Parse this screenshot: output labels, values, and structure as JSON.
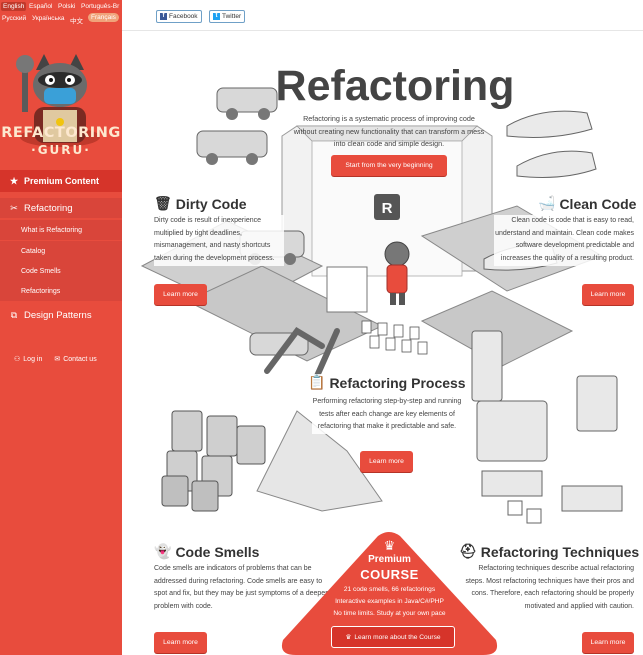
{
  "languages": [
    "English",
    "Español",
    "Polski",
    "Português-Br",
    "Русский",
    "Українська",
    "中文",
    "Français"
  ],
  "brand": {
    "line1": "REFACTORING",
    "line2": "·GURU·"
  },
  "sidebar": {
    "premium": "Premium Content",
    "refactoring": "Refactoring",
    "sub": [
      "What is Refactoring",
      "Catalog",
      "Code Smells",
      "Refactorings"
    ],
    "design_patterns": "Design Patterns",
    "login": "Log in",
    "contact": "Contact us"
  },
  "share": {
    "facebook": "Facebook",
    "twitter": "Twitter"
  },
  "hero": {
    "title": "Refactoring",
    "desc": "Refactoring is a systematic process of improving code without creating new functionality that can transform a mess into clean code and simple design.",
    "cta": "Start from the very beginning"
  },
  "dirty": {
    "title": "Dirty Code",
    "text": "Dirty code is result of inexperience multiplied by tight deadlines, mismanagement, and nasty shortcuts taken during the development process.",
    "btn": "Learn more"
  },
  "clean": {
    "title": "Clean Code",
    "text": "Clean code is code that is easy to read, understand and maintain. Clean code makes software development predictable and increases the quality of a resulting product.",
    "btn": "Learn more"
  },
  "process": {
    "title": "Refactoring Process",
    "text": "Performing refactoring step-by-step and running tests after each change are key elements of refactoring that make it predictable and safe.",
    "btn": "Learn more"
  },
  "smells": {
    "title": "Code Smells",
    "text": "Code smells are indicators of problems that can be addressed during refactoring. Code smells are easy to spot and fix, but they may be just symptoms of a deeper problem with code.",
    "btn": "Learn more"
  },
  "techniques": {
    "title": "Refactoring Techniques",
    "text": "Refactoring techniques describe actual refactoring steps. Most refactoring techniques have their pros and cons. Therefore, each refactoring should be properly motivated and applied with caution.",
    "btn": "Learn more"
  },
  "premium": {
    "label1": "Premium",
    "label2": "COURSE",
    "line1": "21 code smells, 66 refactorings",
    "line2": "Interactive examples in Java/C#/PHP",
    "line3": "No time limits. Study at your own pace",
    "btn": "Learn more about the Course"
  },
  "colors": {
    "accent": "#e84c3d",
    "sidebar": "#e84c3d",
    "brand_text": "#fde8cf"
  }
}
